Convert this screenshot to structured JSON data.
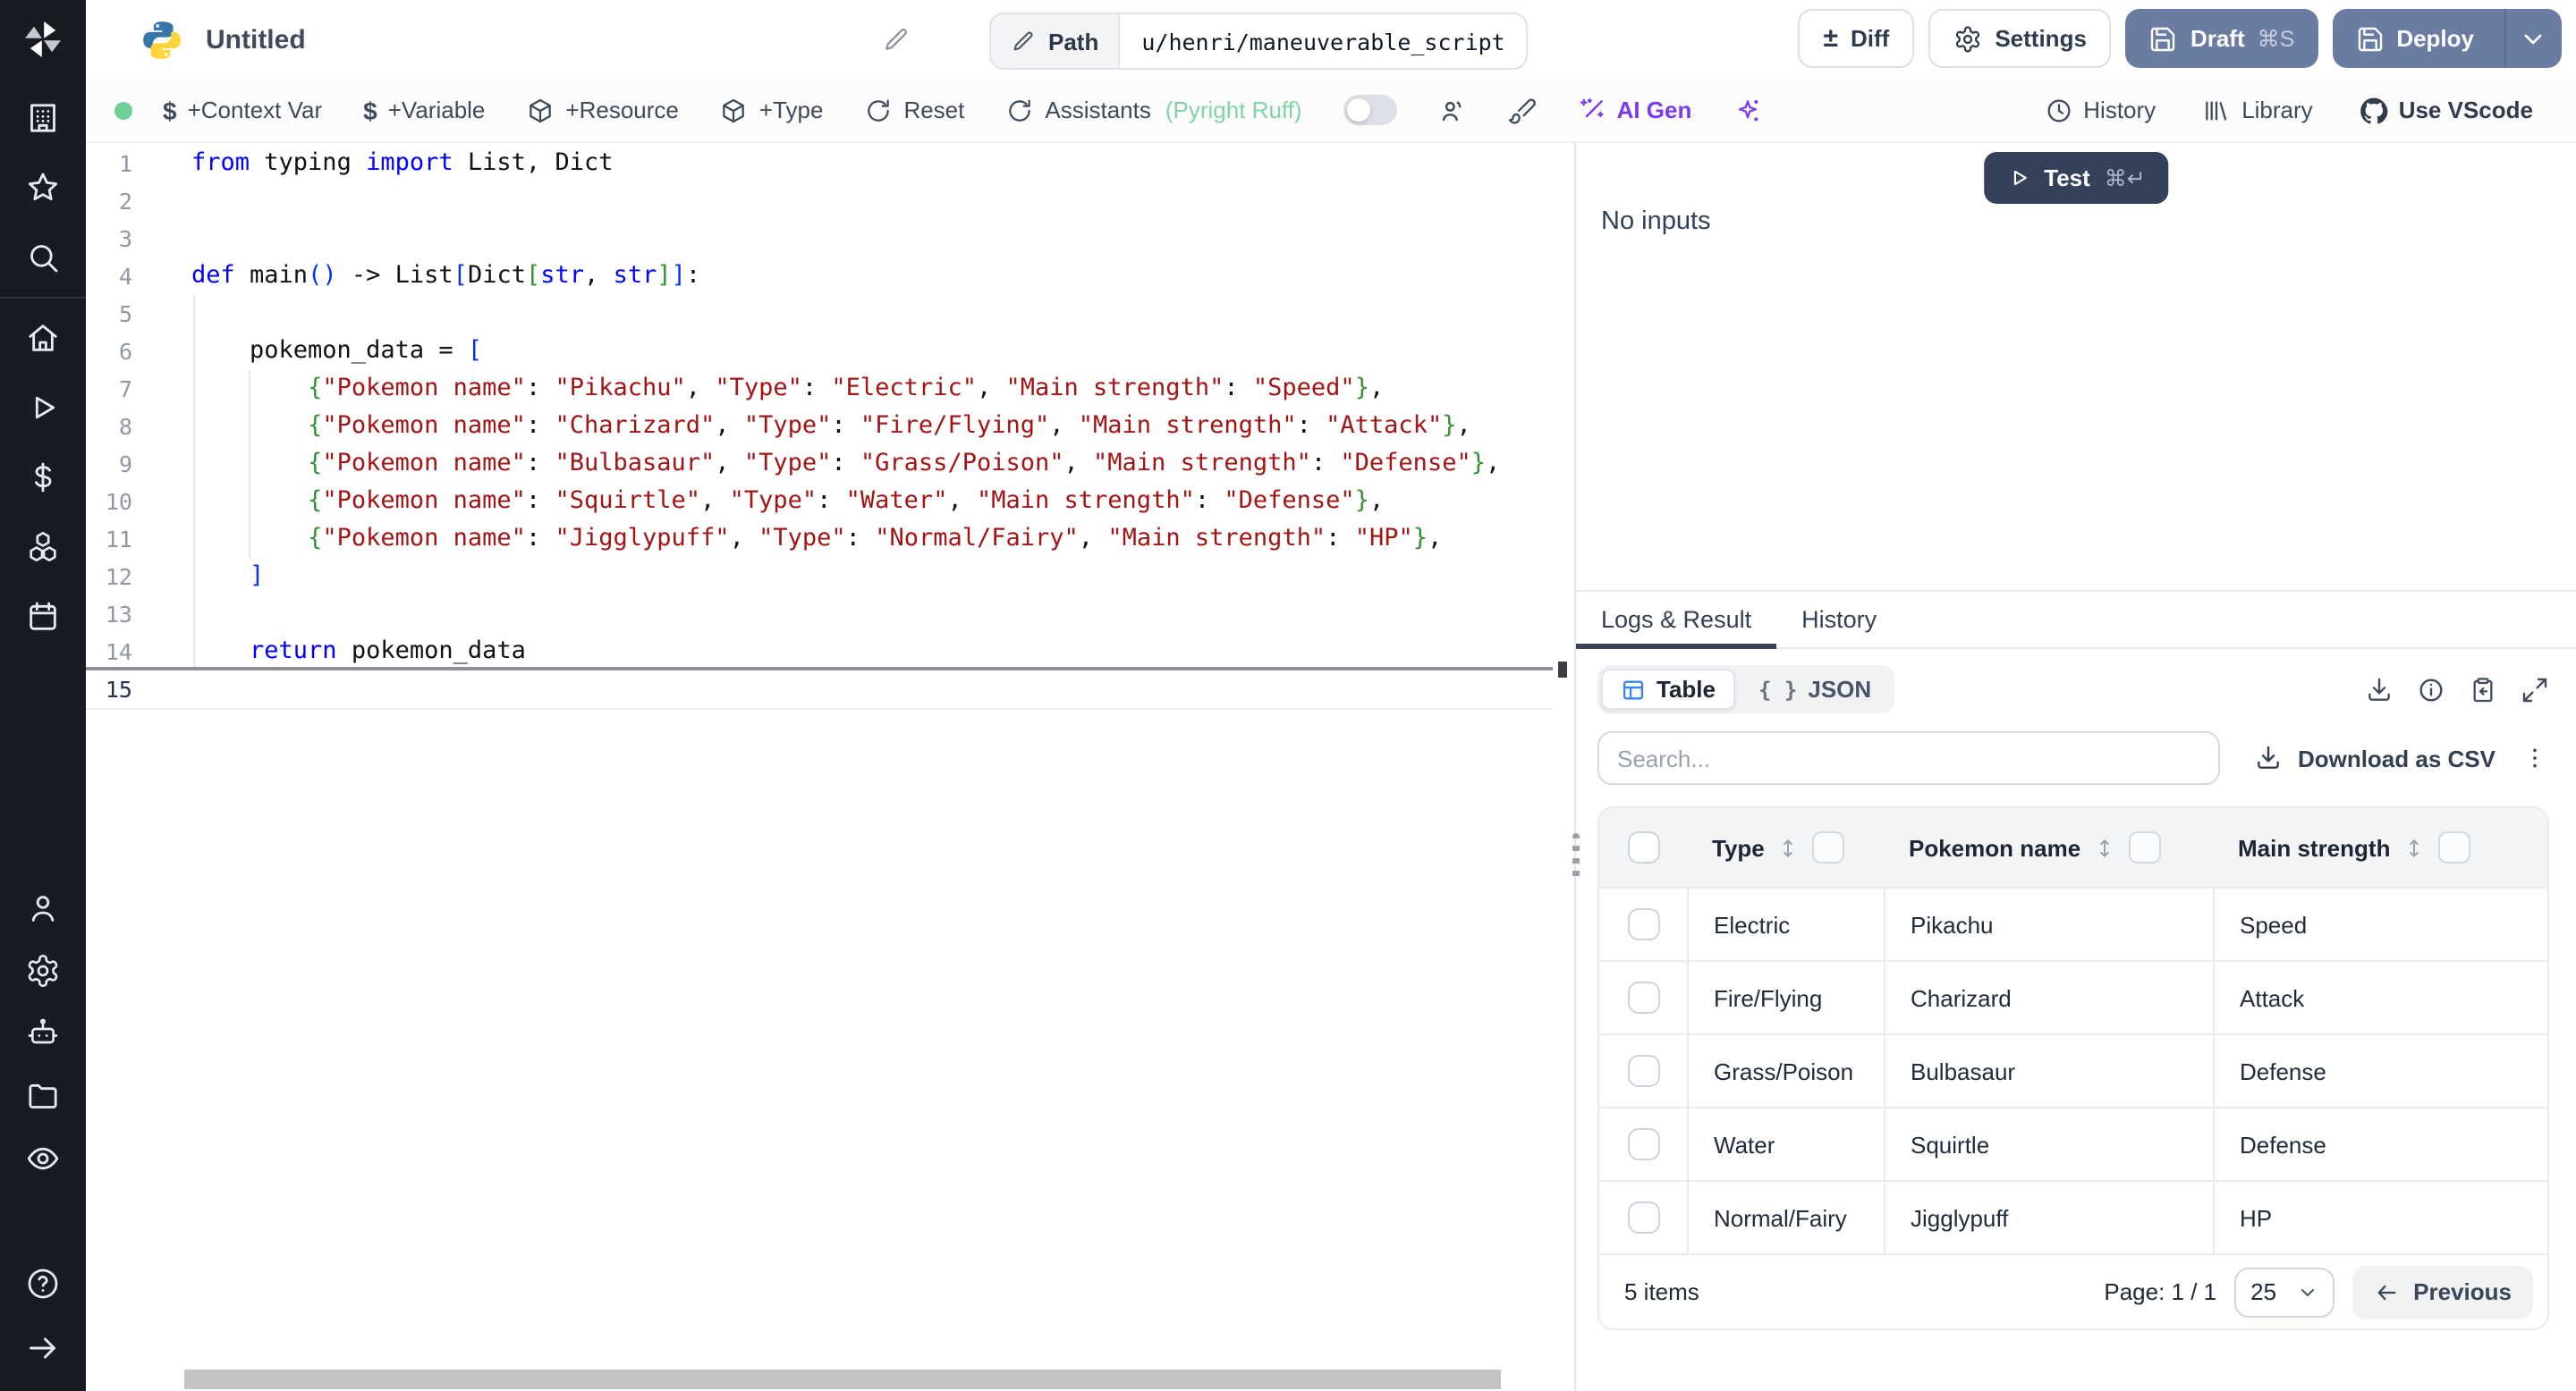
{
  "header": {
    "title": "Untitled",
    "path_label": "Path",
    "path_value": "u/henri/maneuverable_script",
    "diff_label": "Diff",
    "settings_label": "Settings",
    "draft_label": "Draft",
    "draft_shortcut": "⌘S",
    "deploy_label": "Deploy"
  },
  "toolbar": {
    "context_var_label": "+Context Var",
    "variable_label": "+Variable",
    "resource_label": "+Resource",
    "type_label": "+Type",
    "reset_label": "Reset",
    "assistants_label": "Assistants",
    "assistants_status": "(Pyright Ruff)",
    "ai_gen_label": "AI Gen",
    "history_label": "History",
    "library_label": "Library",
    "use_vscode_label": "Use VScode"
  },
  "sidebar_icons": [
    "windmill-logo",
    "building",
    "star",
    "search",
    "home",
    "play",
    "dollar",
    "boxes",
    "calendar",
    "user",
    "gear",
    "robot",
    "folder",
    "eye",
    "help",
    "arrow-right"
  ],
  "editor": {
    "language": "python",
    "lines": [
      {
        "n": 1,
        "seg": [
          [
            "k",
            "from"
          ],
          [
            "t",
            " typing "
          ],
          [
            "k",
            "import"
          ],
          [
            "t",
            " List, Dict"
          ]
        ]
      },
      {
        "n": 2,
        "seg": []
      },
      {
        "n": 3,
        "seg": []
      },
      {
        "n": 4,
        "seg": [
          [
            "k",
            "def"
          ],
          [
            "t",
            " main"
          ],
          [
            "b1",
            "()"
          ],
          [
            "t",
            " -> List"
          ],
          [
            "b1",
            "["
          ],
          [
            "t",
            "Dict"
          ],
          [
            "b2",
            "["
          ],
          [
            "k",
            "str"
          ],
          [
            "t",
            ", "
          ],
          [
            "k",
            "str"
          ],
          [
            "b2",
            "]"
          ],
          [
            "b1",
            "]"
          ],
          [
            "t",
            ":"
          ]
        ]
      },
      {
        "n": 5,
        "seg": []
      },
      {
        "n": 6,
        "seg": [
          [
            "t",
            "    pokemon_data = "
          ],
          [
            "b1",
            "["
          ]
        ]
      },
      {
        "n": 7,
        "seg": [
          [
            "t",
            "        "
          ],
          [
            "b2",
            "{"
          ],
          [
            "s",
            "\"Pokemon name\""
          ],
          [
            "t",
            ": "
          ],
          [
            "s",
            "\"Pikachu\""
          ],
          [
            "t",
            ", "
          ],
          [
            "s",
            "\"Type\""
          ],
          [
            "t",
            ": "
          ],
          [
            "s",
            "\"Electric\""
          ],
          [
            "t",
            ", "
          ],
          [
            "s",
            "\"Main strength\""
          ],
          [
            "t",
            ": "
          ],
          [
            "s",
            "\"Speed\""
          ],
          [
            "b2",
            "}"
          ],
          [
            "t",
            ","
          ]
        ]
      },
      {
        "n": 8,
        "seg": [
          [
            "t",
            "        "
          ],
          [
            "b2",
            "{"
          ],
          [
            "s",
            "\"Pokemon name\""
          ],
          [
            "t",
            ": "
          ],
          [
            "s",
            "\"Charizard\""
          ],
          [
            "t",
            ", "
          ],
          [
            "s",
            "\"Type\""
          ],
          [
            "t",
            ": "
          ],
          [
            "s",
            "\"Fire/Flying\""
          ],
          [
            "t",
            ", "
          ],
          [
            "s",
            "\"Main strength\""
          ],
          [
            "t",
            ": "
          ],
          [
            "s",
            "\"Attack\""
          ],
          [
            "b2",
            "}"
          ],
          [
            "t",
            ","
          ]
        ]
      },
      {
        "n": 9,
        "seg": [
          [
            "t",
            "        "
          ],
          [
            "b2",
            "{"
          ],
          [
            "s",
            "\"Pokemon name\""
          ],
          [
            "t",
            ": "
          ],
          [
            "s",
            "\"Bulbasaur\""
          ],
          [
            "t",
            ", "
          ],
          [
            "s",
            "\"Type\""
          ],
          [
            "t",
            ": "
          ],
          [
            "s",
            "\"Grass/Poison\""
          ],
          [
            "t",
            ", "
          ],
          [
            "s",
            "\"Main strength\""
          ],
          [
            "t",
            ": "
          ],
          [
            "s",
            "\"Defense\""
          ],
          [
            "b2",
            "}"
          ],
          [
            "t",
            ","
          ]
        ]
      },
      {
        "n": 10,
        "seg": [
          [
            "t",
            "        "
          ],
          [
            "b2",
            "{"
          ],
          [
            "s",
            "\"Pokemon name\""
          ],
          [
            "t",
            ": "
          ],
          [
            "s",
            "\"Squirtle\""
          ],
          [
            "t",
            ", "
          ],
          [
            "s",
            "\"Type\""
          ],
          [
            "t",
            ": "
          ],
          [
            "s",
            "\"Water\""
          ],
          [
            "t",
            ", "
          ],
          [
            "s",
            "\"Main strength\""
          ],
          [
            "t",
            ": "
          ],
          [
            "s",
            "\"Defense\""
          ],
          [
            "b2",
            "}"
          ],
          [
            "t",
            ","
          ]
        ]
      },
      {
        "n": 11,
        "seg": [
          [
            "t",
            "        "
          ],
          [
            "b2",
            "{"
          ],
          [
            "s",
            "\"Pokemon name\""
          ],
          [
            "t",
            ": "
          ],
          [
            "s",
            "\"Jigglypuff\""
          ],
          [
            "t",
            ", "
          ],
          [
            "s",
            "\"Type\""
          ],
          [
            "t",
            ": "
          ],
          [
            "s",
            "\"Normal/Fairy\""
          ],
          [
            "t",
            ", "
          ],
          [
            "s",
            "\"Main strength\""
          ],
          [
            "t",
            ": "
          ],
          [
            "s",
            "\"HP\""
          ],
          [
            "b2",
            "}"
          ],
          [
            "t",
            ","
          ]
        ]
      },
      {
        "n": 12,
        "seg": [
          [
            "t",
            "    "
          ],
          [
            "b1",
            "]"
          ]
        ]
      },
      {
        "n": 13,
        "seg": []
      },
      {
        "n": 14,
        "seg": [
          [
            "t",
            "    "
          ],
          [
            "k",
            "return"
          ],
          [
            "t",
            " pokemon_data"
          ]
        ]
      },
      {
        "n": 15,
        "seg": [],
        "active": true
      }
    ]
  },
  "run_panel": {
    "test_label": "Test",
    "test_shortcut": "⌘↵",
    "no_inputs": "No inputs"
  },
  "result_panel": {
    "tabs": [
      {
        "label": "Logs & Result",
        "active": true
      },
      {
        "label": "History",
        "active": false
      }
    ],
    "view_toggle": [
      {
        "label": "Table",
        "active": true
      },
      {
        "label": "JSON",
        "active": false
      }
    ],
    "search_placeholder": "Search...",
    "download_csv_label": "Download as CSV",
    "table": {
      "columns": [
        "Type",
        "Pokemon name",
        "Main strength"
      ],
      "rows": [
        [
          "Electric",
          "Pikachu",
          "Speed"
        ],
        [
          "Fire/Flying",
          "Charizard",
          "Attack"
        ],
        [
          "Grass/Poison",
          "Bulbasaur",
          "Defense"
        ],
        [
          "Water",
          "Squirtle",
          "Defense"
        ],
        [
          "Normal/Fairy",
          "Jigglypuff",
          "HP"
        ]
      ]
    },
    "footer": {
      "items_count": "5 items",
      "page_label": "Page: 1 / 1",
      "page_size": "25",
      "previous_label": "Previous"
    }
  },
  "colors": {
    "accent_slate_button": "#6a7ca2",
    "dark_button": "#35415a",
    "ai_purple": "#7c3aed",
    "status_green": "#6fcf97",
    "table_icon_blue": "#3b82f6",
    "code_keyword": "#0000ff",
    "code_string": "#a31515",
    "bracket_level1": "#0431fa",
    "bracket_level2": "#319331"
  }
}
